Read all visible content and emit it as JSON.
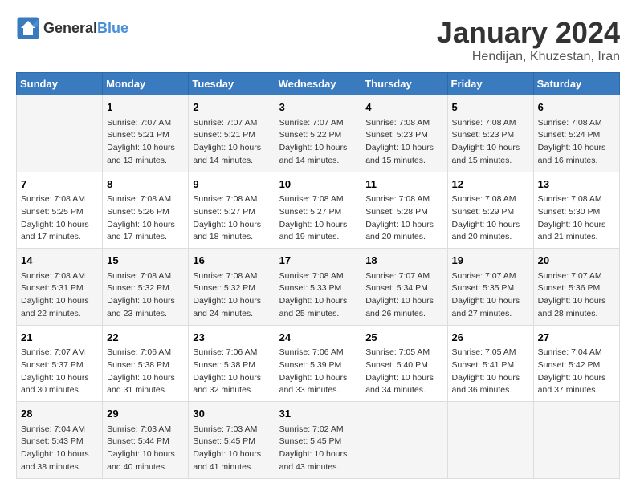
{
  "header": {
    "logo_general": "General",
    "logo_blue": "Blue",
    "month_year": "January 2024",
    "location": "Hendijan, Khuzestan, Iran"
  },
  "weekdays": [
    "Sunday",
    "Monday",
    "Tuesday",
    "Wednesday",
    "Thursday",
    "Friday",
    "Saturday"
  ],
  "weeks": [
    [
      {
        "day": "",
        "sunrise": "",
        "sunset": "",
        "daylight": ""
      },
      {
        "day": "1",
        "sunrise": "Sunrise: 7:07 AM",
        "sunset": "Sunset: 5:21 PM",
        "daylight": "Daylight: 10 hours and 13 minutes."
      },
      {
        "day": "2",
        "sunrise": "Sunrise: 7:07 AM",
        "sunset": "Sunset: 5:21 PM",
        "daylight": "Daylight: 10 hours and 14 minutes."
      },
      {
        "day": "3",
        "sunrise": "Sunrise: 7:07 AM",
        "sunset": "Sunset: 5:22 PM",
        "daylight": "Daylight: 10 hours and 14 minutes."
      },
      {
        "day": "4",
        "sunrise": "Sunrise: 7:08 AM",
        "sunset": "Sunset: 5:23 PM",
        "daylight": "Daylight: 10 hours and 15 minutes."
      },
      {
        "day": "5",
        "sunrise": "Sunrise: 7:08 AM",
        "sunset": "Sunset: 5:23 PM",
        "daylight": "Daylight: 10 hours and 15 minutes."
      },
      {
        "day": "6",
        "sunrise": "Sunrise: 7:08 AM",
        "sunset": "Sunset: 5:24 PM",
        "daylight": "Daylight: 10 hours and 16 minutes."
      }
    ],
    [
      {
        "day": "7",
        "sunrise": "Sunrise: 7:08 AM",
        "sunset": "Sunset: 5:25 PM",
        "daylight": "Daylight: 10 hours and 17 minutes."
      },
      {
        "day": "8",
        "sunrise": "Sunrise: 7:08 AM",
        "sunset": "Sunset: 5:26 PM",
        "daylight": "Daylight: 10 hours and 17 minutes."
      },
      {
        "day": "9",
        "sunrise": "Sunrise: 7:08 AM",
        "sunset": "Sunset: 5:27 PM",
        "daylight": "Daylight: 10 hours and 18 minutes."
      },
      {
        "day": "10",
        "sunrise": "Sunrise: 7:08 AM",
        "sunset": "Sunset: 5:27 PM",
        "daylight": "Daylight: 10 hours and 19 minutes."
      },
      {
        "day": "11",
        "sunrise": "Sunrise: 7:08 AM",
        "sunset": "Sunset: 5:28 PM",
        "daylight": "Daylight: 10 hours and 20 minutes."
      },
      {
        "day": "12",
        "sunrise": "Sunrise: 7:08 AM",
        "sunset": "Sunset: 5:29 PM",
        "daylight": "Daylight: 10 hours and 20 minutes."
      },
      {
        "day": "13",
        "sunrise": "Sunrise: 7:08 AM",
        "sunset": "Sunset: 5:30 PM",
        "daylight": "Daylight: 10 hours and 21 minutes."
      }
    ],
    [
      {
        "day": "14",
        "sunrise": "Sunrise: 7:08 AM",
        "sunset": "Sunset: 5:31 PM",
        "daylight": "Daylight: 10 hours and 22 minutes."
      },
      {
        "day": "15",
        "sunrise": "Sunrise: 7:08 AM",
        "sunset": "Sunset: 5:32 PM",
        "daylight": "Daylight: 10 hours and 23 minutes."
      },
      {
        "day": "16",
        "sunrise": "Sunrise: 7:08 AM",
        "sunset": "Sunset: 5:32 PM",
        "daylight": "Daylight: 10 hours and 24 minutes."
      },
      {
        "day": "17",
        "sunrise": "Sunrise: 7:08 AM",
        "sunset": "Sunset: 5:33 PM",
        "daylight": "Daylight: 10 hours and 25 minutes."
      },
      {
        "day": "18",
        "sunrise": "Sunrise: 7:07 AM",
        "sunset": "Sunset: 5:34 PM",
        "daylight": "Daylight: 10 hours and 26 minutes."
      },
      {
        "day": "19",
        "sunrise": "Sunrise: 7:07 AM",
        "sunset": "Sunset: 5:35 PM",
        "daylight": "Daylight: 10 hours and 27 minutes."
      },
      {
        "day": "20",
        "sunrise": "Sunrise: 7:07 AM",
        "sunset": "Sunset: 5:36 PM",
        "daylight": "Daylight: 10 hours and 28 minutes."
      }
    ],
    [
      {
        "day": "21",
        "sunrise": "Sunrise: 7:07 AM",
        "sunset": "Sunset: 5:37 PM",
        "daylight": "Daylight: 10 hours and 30 minutes."
      },
      {
        "day": "22",
        "sunrise": "Sunrise: 7:06 AM",
        "sunset": "Sunset: 5:38 PM",
        "daylight": "Daylight: 10 hours and 31 minutes."
      },
      {
        "day": "23",
        "sunrise": "Sunrise: 7:06 AM",
        "sunset": "Sunset: 5:38 PM",
        "daylight": "Daylight: 10 hours and 32 minutes."
      },
      {
        "day": "24",
        "sunrise": "Sunrise: 7:06 AM",
        "sunset": "Sunset: 5:39 PM",
        "daylight": "Daylight: 10 hours and 33 minutes."
      },
      {
        "day": "25",
        "sunrise": "Sunrise: 7:05 AM",
        "sunset": "Sunset: 5:40 PM",
        "daylight": "Daylight: 10 hours and 34 minutes."
      },
      {
        "day": "26",
        "sunrise": "Sunrise: 7:05 AM",
        "sunset": "Sunset: 5:41 PM",
        "daylight": "Daylight: 10 hours and 36 minutes."
      },
      {
        "day": "27",
        "sunrise": "Sunrise: 7:04 AM",
        "sunset": "Sunset: 5:42 PM",
        "daylight": "Daylight: 10 hours and 37 minutes."
      }
    ],
    [
      {
        "day": "28",
        "sunrise": "Sunrise: 7:04 AM",
        "sunset": "Sunset: 5:43 PM",
        "daylight": "Daylight: 10 hours and 38 minutes."
      },
      {
        "day": "29",
        "sunrise": "Sunrise: 7:03 AM",
        "sunset": "Sunset: 5:44 PM",
        "daylight": "Daylight: 10 hours and 40 minutes."
      },
      {
        "day": "30",
        "sunrise": "Sunrise: 7:03 AM",
        "sunset": "Sunset: 5:45 PM",
        "daylight": "Daylight: 10 hours and 41 minutes."
      },
      {
        "day": "31",
        "sunrise": "Sunrise: 7:02 AM",
        "sunset": "Sunset: 5:45 PM",
        "daylight": "Daylight: 10 hours and 43 minutes."
      },
      {
        "day": "",
        "sunrise": "",
        "sunset": "",
        "daylight": ""
      },
      {
        "day": "",
        "sunrise": "",
        "sunset": "",
        "daylight": ""
      },
      {
        "day": "",
        "sunrise": "",
        "sunset": "",
        "daylight": ""
      }
    ]
  ]
}
